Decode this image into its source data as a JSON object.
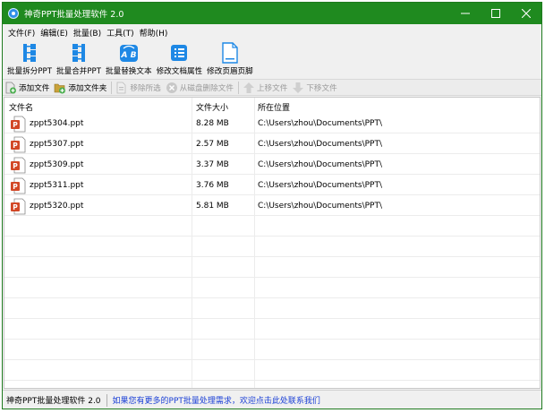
{
  "window": {
    "title": "神奇PPT批量处理软件 2.0",
    "controls": {
      "minimize": "—",
      "maximize": "☐",
      "close": "✕"
    }
  },
  "menu": [
    {
      "label": "文件(F)"
    },
    {
      "label": "编辑(E)"
    },
    {
      "label": "批量(B)"
    },
    {
      "label": "工具(T)"
    },
    {
      "label": "帮助(H)"
    }
  ],
  "big_toolbar": [
    {
      "label": "批量拆分PPT",
      "icon": "split-icon"
    },
    {
      "label": "批量合并PPT",
      "icon": "merge-icon"
    },
    {
      "label": "批量替换文本",
      "icon": "replace-text-icon"
    },
    {
      "label": "修改文档属性",
      "icon": "document-properties-icon"
    },
    {
      "label": "修改页眉页脚",
      "icon": "header-footer-icon"
    }
  ],
  "small_toolbar": [
    {
      "label": "添加文件",
      "icon": "add-file-icon",
      "enabled": true
    },
    {
      "label": "添加文件夹",
      "icon": "add-folder-icon",
      "enabled": true
    },
    {
      "label": "移除所选",
      "icon": "remove-selected-icon",
      "enabled": false
    },
    {
      "label": "从磁盘删除文件",
      "icon": "delete-from-disk-icon",
      "enabled": false
    },
    {
      "label": "上移文件",
      "icon": "move-up-icon",
      "enabled": false
    },
    {
      "label": "下移文件",
      "icon": "move-down-icon",
      "enabled": false
    }
  ],
  "file_list": {
    "columns": [
      "文件名",
      "文件大小",
      "所在位置"
    ],
    "rows": [
      {
        "name": "zppt5304.ppt",
        "size": "8.28 MB",
        "location": "C:\\Users\\zhou\\Documents\\PPT\\"
      },
      {
        "name": "zppt5307.ppt",
        "size": "2.57 MB",
        "location": "C:\\Users\\zhou\\Documents\\PPT\\"
      },
      {
        "name": "zppt5309.ppt",
        "size": "3.37 MB",
        "location": "C:\\Users\\zhou\\Documents\\PPT\\"
      },
      {
        "name": "zppt5311.ppt",
        "size": "3.76 MB",
        "location": "C:\\Users\\zhou\\Documents\\PPT\\"
      },
      {
        "name": "zppt5320.ppt",
        "size": "5.81 MB",
        "location": "C:\\Users\\zhou\\Documents\\PPT\\"
      }
    ]
  },
  "status_bar": {
    "app_name": "神奇PPT批量处理软件 2.0",
    "link_text": "如果您有更多的PPT批量处理需求，欢迎点击此处联系我们"
  },
  "colors": {
    "titlebar": "#1f8a1f",
    "toolbar_icon_blue": "#1e88e5",
    "ppt_red": "#d24726",
    "link_blue": "#1a3fd6"
  }
}
